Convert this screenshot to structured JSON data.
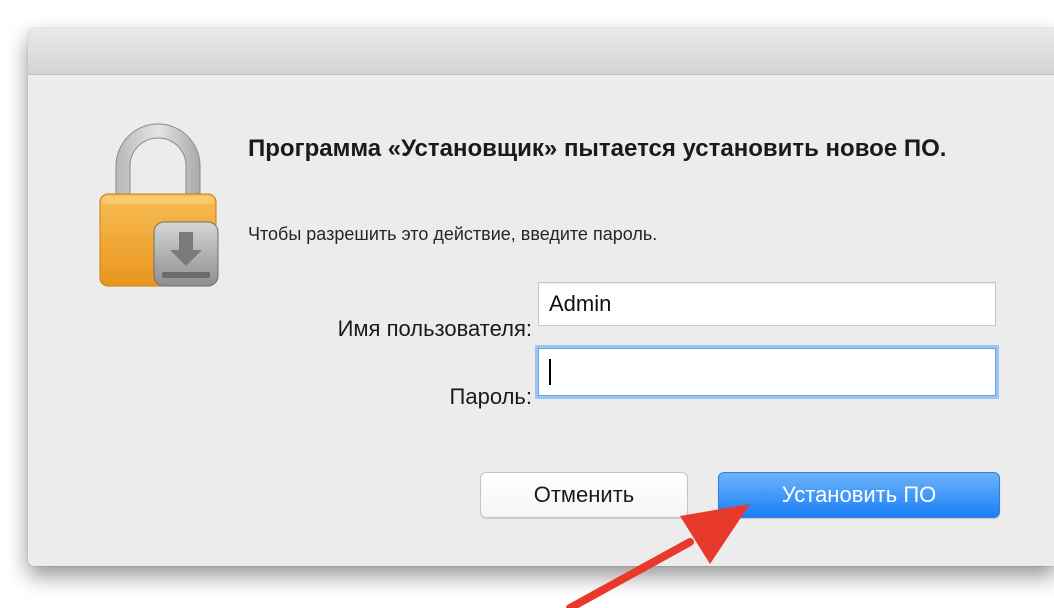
{
  "dialog": {
    "title": "Программа «Установщик» пытается установить новое ПО.",
    "subtitle": "Чтобы разрешить это действие, введите пароль.",
    "icon": "lock-icon",
    "username_label": "Имя пользователя:",
    "username_value": "Admin",
    "password_label": "Пароль:",
    "password_value": "",
    "cancel_label": "Отменить",
    "install_label": "Установить ПО"
  },
  "annotation": {
    "icon": "red-arrow",
    "color": "#e83a2c"
  },
  "colors": {
    "accent": "#1a7ff5",
    "focus_ring": "#9ec4f3",
    "lock_body": "#f1a53a"
  }
}
